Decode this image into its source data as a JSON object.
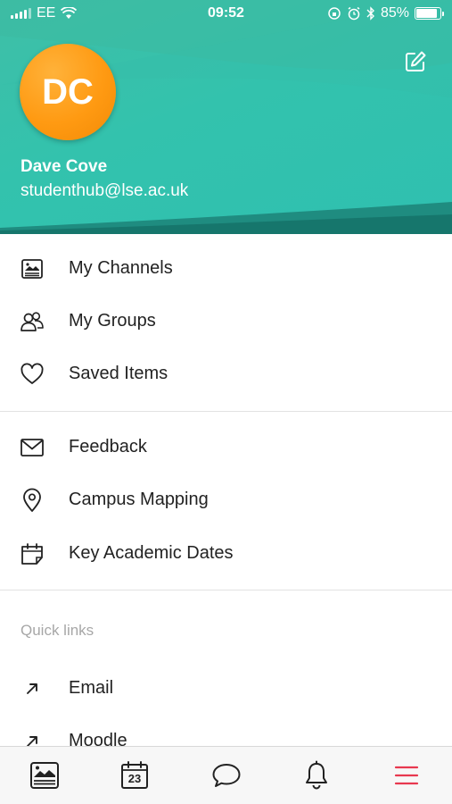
{
  "status_bar": {
    "carrier": "EE",
    "time": "09:52",
    "battery_percent": "85%",
    "battery_level": 0.85
  },
  "profile": {
    "initials": "DC",
    "name": "Dave Cove",
    "email": "studenthub@lse.ac.uk",
    "avatar_color": "#ff9a12"
  },
  "menu_section_1": [
    {
      "label": "My Channels",
      "icon": "channels-icon"
    },
    {
      "label": "My Groups",
      "icon": "groups-icon"
    },
    {
      "label": "Saved Items",
      "icon": "heart-icon"
    }
  ],
  "menu_section_2": [
    {
      "label": "Feedback",
      "icon": "envelope-icon"
    },
    {
      "label": "Campus Mapping",
      "icon": "location-pin-icon"
    },
    {
      "label": "Key Academic Dates",
      "icon": "calendar-icon"
    }
  ],
  "quick_links": {
    "title": "Quick links",
    "items": [
      {
        "label": "Email",
        "icon": "external-link-icon"
      },
      {
        "label": "Moodle",
        "icon": "external-link-icon"
      }
    ]
  },
  "tabbar": {
    "calendar_day": "23",
    "active_tab": "menu",
    "active_color": "#e8394f",
    "icons": [
      "feed-icon",
      "calendar-icon",
      "chat-icon",
      "bell-icon",
      "menu-icon"
    ]
  },
  "colors": {
    "header_teal": "#33c2ad",
    "header_dark_teal": "#1e8579"
  }
}
